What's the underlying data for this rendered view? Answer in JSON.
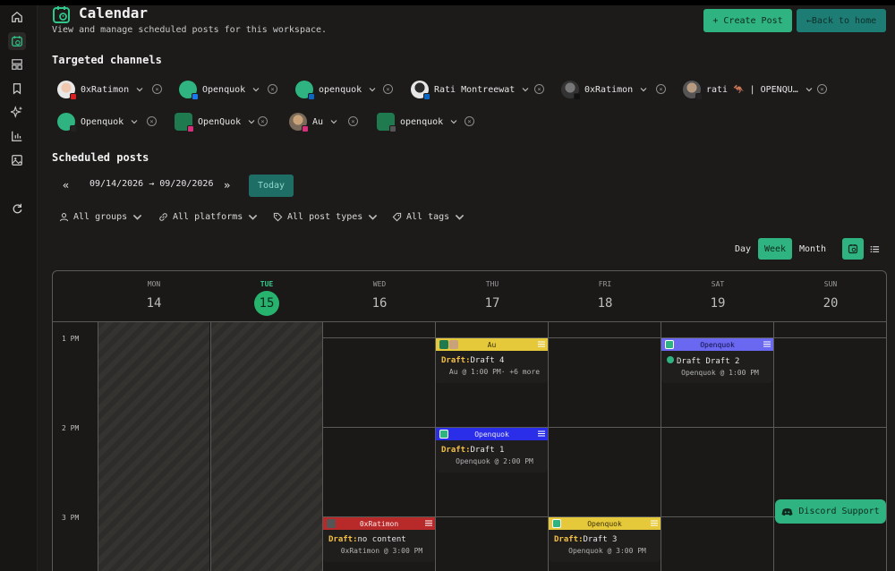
{
  "header": {
    "title": "Calendar",
    "subtitle": "View and manage scheduled posts for this workspace.",
    "create_post": "+ Create Post",
    "back_home": "←Back to home"
  },
  "sidebar": {
    "items": [
      "home-icon",
      "calendar-icon",
      "layout-icon",
      "bookmark-icon",
      "sparkles-icon",
      "chart-icon",
      "image-icon",
      "refresh-icon"
    ]
  },
  "targeted_channels": {
    "title": "Targeted channels",
    "channels": [
      {
        "name": "0xRatimon",
        "platform": "youtube"
      },
      {
        "name": "Openquok",
        "platform": "facebook"
      },
      {
        "name": "openquok",
        "platform": "linkedin"
      },
      {
        "name": "Rati Montreewat",
        "platform": "linkedin"
      },
      {
        "name": "0xRatimon",
        "platform": "tiktok"
      },
      {
        "name": "rati 🦘 | OPENQU…",
        "platform": "x"
      },
      {
        "name": "Openquok",
        "platform": "x"
      },
      {
        "name": "OpenQuok",
        "platform": "instagram"
      },
      {
        "name": "Au",
        "platform": "instagram"
      },
      {
        "name": "openquok",
        "platform": "threads"
      }
    ]
  },
  "scheduled": {
    "title": "Scheduled posts",
    "prev": "«",
    "next": "»",
    "range": "09/14/2026 → 09/20/2026",
    "today": "Today"
  },
  "filters": {
    "groups": "All groups",
    "platforms": "All platforms",
    "post_types": "All post types",
    "tags": "All tags"
  },
  "views": {
    "day": "Day",
    "week": "Week",
    "month": "Month",
    "active": "Week"
  },
  "calendar": {
    "days": [
      {
        "name": "MON",
        "num": "14"
      },
      {
        "name": "TUE",
        "num": "15",
        "today": true
      },
      {
        "name": "WED",
        "num": "16"
      },
      {
        "name": "THU",
        "num": "17"
      },
      {
        "name": "FRI",
        "num": "18"
      },
      {
        "name": "SAT",
        "num": "19"
      },
      {
        "name": "SUN",
        "num": "20"
      }
    ],
    "hours": [
      "1 PM",
      "2 PM",
      "3 PM"
    ],
    "events": [
      {
        "channel": "Au",
        "color": "#e6c93a",
        "draft_label": "Draft:",
        "title": "Draft 4",
        "meta": "Au @ 1:00 PM· +6 more"
      },
      {
        "channel": "Openquok",
        "color": "#6a67f0",
        "draft_label": "Draft",
        "title": "Draft 2",
        "meta": "Openquok @ 1:00 PM"
      },
      {
        "channel": "Openquok",
        "color": "#2a2ee8",
        "draft_label": "Draft:",
        "title": "Draft 1",
        "meta": "Openquok @ 2:00 PM"
      },
      {
        "channel": "0xRatimon",
        "color": "#b82a2a",
        "draft_label": "Draft:",
        "title": "no content",
        "meta": "0xRatimon @ 3:00 PM"
      },
      {
        "channel": "Openquok",
        "color": "#e6c93a",
        "draft_label": "Draft:",
        "title": "Draft 3",
        "meta": "Openquok @ 3:00 PM"
      }
    ]
  },
  "support": {
    "label": "Discord Support"
  },
  "colors": {
    "accent": "#2fb380",
    "today_green": "#27b36e",
    "draft_yellow": "#f4c042",
    "background": "#1c1b1a"
  }
}
